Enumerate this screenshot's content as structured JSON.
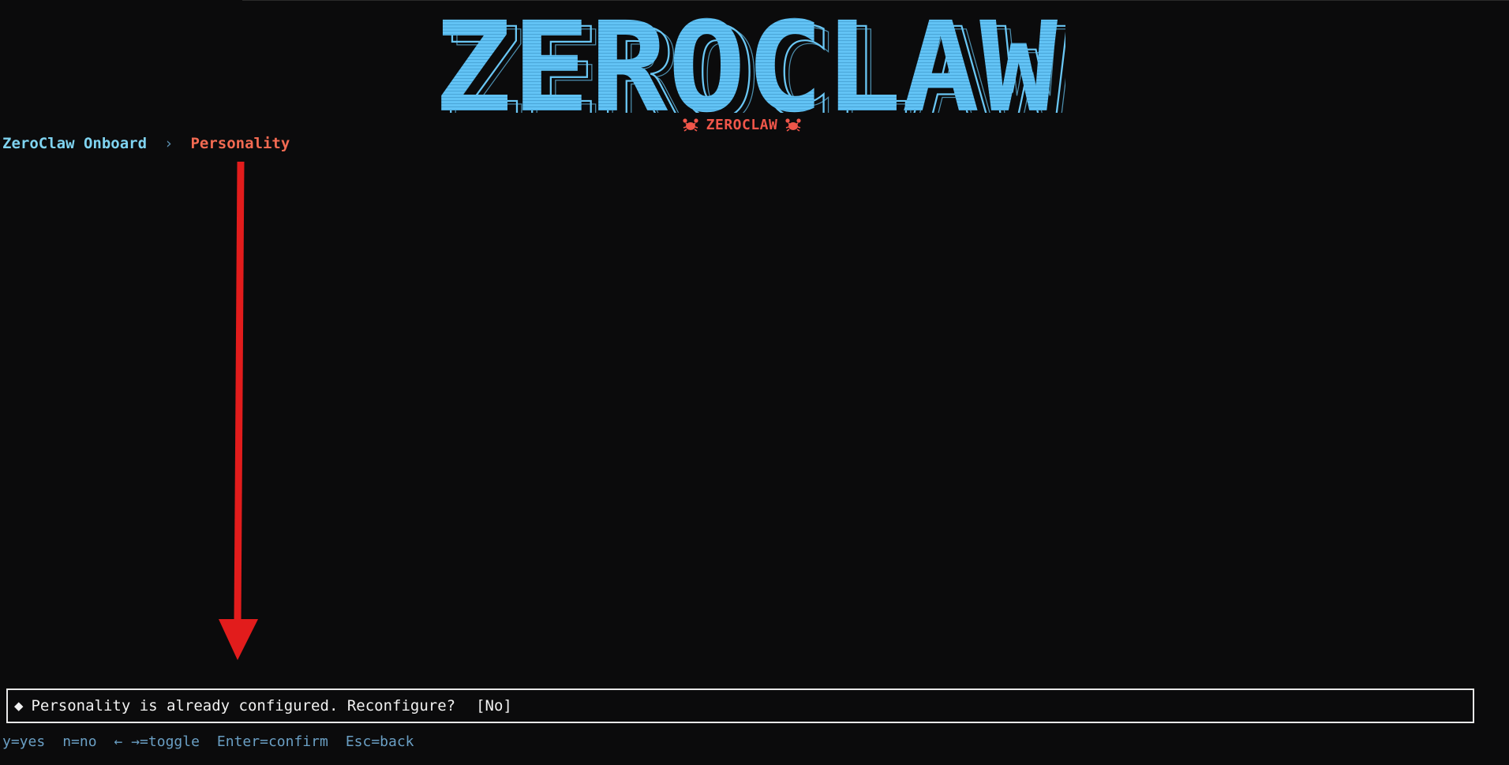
{
  "banner": {
    "title": "ZEROCLAW",
    "subtitle": "ZEROCLAW",
    "title_color": "#6ac7f5",
    "subtitle_color": "#f0564a",
    "icon": "crab-icon"
  },
  "breadcrumb": {
    "root": "ZeroClaw Onboard",
    "separator": "›",
    "current": "Personality",
    "root_color": "#7fd3f0",
    "current_color": "#f26a52"
  },
  "annotation": {
    "icon": "down-arrow-icon",
    "color": "#e21c1c"
  },
  "prompt": {
    "bullet": "◆",
    "question": "Personality is already configured. Reconfigure?",
    "answer": "[No]"
  },
  "hints": [
    "y=yes",
    "n=no",
    "← →=toggle",
    "Enter=confirm",
    "Esc=back"
  ],
  "colors": {
    "background": "#0b0b0c",
    "hint": "#6a9fc4",
    "border": "#e8e8e8"
  }
}
